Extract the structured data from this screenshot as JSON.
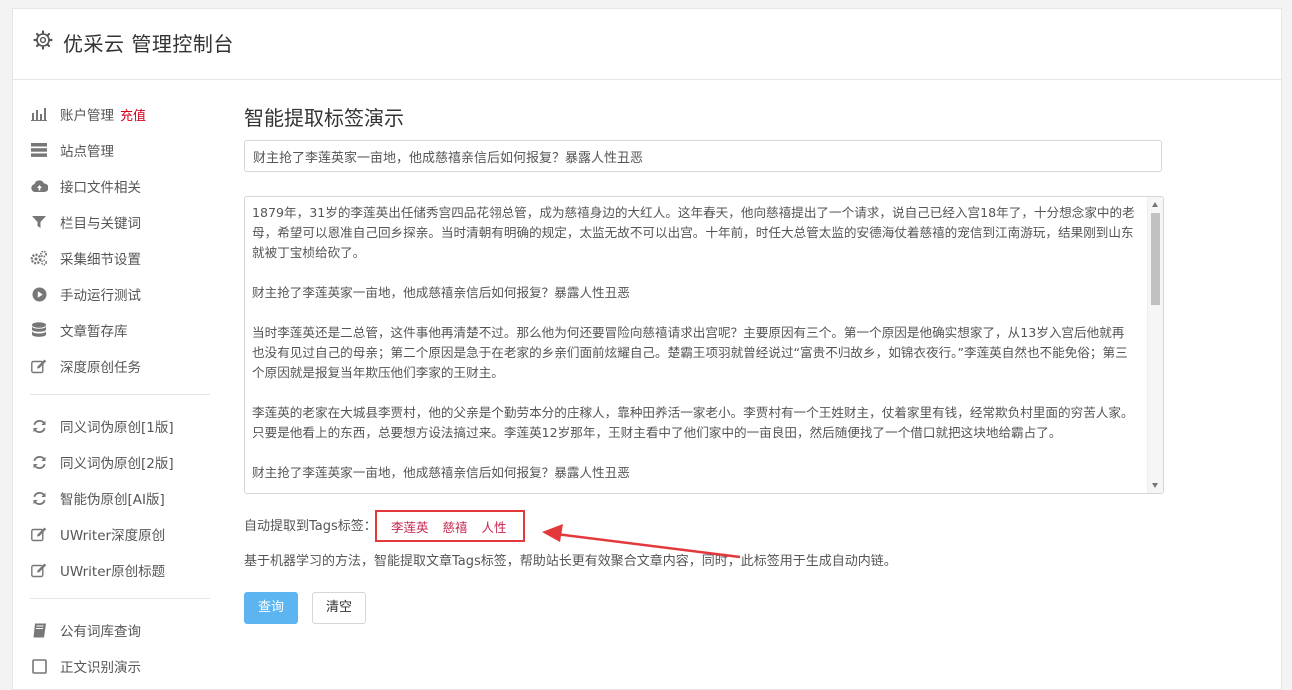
{
  "app": {
    "title": "优采云 管理控制台"
  },
  "sidebar": {
    "groups": [
      [
        {
          "icon": "bar-chart-icon",
          "label": "账户管理",
          "badge": "充值"
        },
        {
          "icon": "server-icon",
          "label": "站点管理"
        },
        {
          "icon": "cloud-upload-icon",
          "label": "接口文件相关"
        },
        {
          "icon": "filter-icon",
          "label": "栏目与关键词"
        },
        {
          "icon": "gears-icon",
          "label": "采集细节设置"
        },
        {
          "icon": "play-circle-icon",
          "label": "手动运行测试"
        },
        {
          "icon": "database-icon",
          "label": "文章暂存库"
        },
        {
          "icon": "edit-icon",
          "label": "深度原创任务"
        }
      ],
      [
        {
          "icon": "refresh-icon",
          "label": "同义词伪原创[1版]"
        },
        {
          "icon": "refresh-icon",
          "label": "同义词伪原创[2版]"
        },
        {
          "icon": "refresh-icon",
          "label": "智能伪原创[AI版]"
        },
        {
          "icon": "edit-icon",
          "label": "UWriter深度原创"
        },
        {
          "icon": "edit-icon",
          "label": "UWriter原创标题"
        }
      ],
      [
        {
          "icon": "book-icon",
          "label": "公有词库查询"
        },
        {
          "icon": "square-icon",
          "label": "正文识别演示"
        }
      ]
    ]
  },
  "main": {
    "heading": "智能提取标签演示",
    "title_value": "财主抢了李莲英家一亩地，他成慈禧亲信后如何报复？暴露人性丑恶",
    "content_paragraphs": [
      "1879年，31岁的李莲英出任储秀宫四品花翎总管，成为慈禧身边的大红人。这年春天，他向慈禧提出了一个请求，说自己已经入宫18年了，十分想念家中的老母，希望可以恩准自己回乡探亲。当时清朝有明确的规定，太监无故不可以出宫。十年前，时任大总管太监的安德海仗着慈禧的宠信到江南游玩，结果刚到山东就被丁宝桢给砍了。",
      "财主抢了李莲英家一亩地，他成慈禧亲信后如何报复？暴露人性丑恶",
      "当时李莲英还是二总管，这件事他再清楚不过。那么他为何还要冒险向慈禧请求出宫呢？主要原因有三个。第一个原因是他确实想家了，从13岁入宫后他就再也没有见过自己的母亲；第二个原因是急于在老家的乡亲们面前炫耀自己。楚霸王项羽就曾经说过“富贵不归故乡，如锦衣夜行。”李莲英自然也不能免俗；第三个原因就是报复当年欺压他们李家的王财主。",
      "李莲英的老家在大城县李贾村，他的父亲是个勤劳本分的庄稼人，靠种田养活一家老小。李贾村有一个王姓财主，仗着家里有钱，经常欺负村里面的穷苦人家。只要是他看上的东西，总要想方设法搞过来。李莲英12岁那年，王财主看中了他们家中的一亩良田，然后随便找了一个借口就把这块地给霸占了。",
      "财主抢了李莲英家一亩地，他成慈禧亲信后如何报复？暴露人性丑恶"
    ],
    "tags_label": "自动提取到Tags标签：",
    "tags": [
      "李莲英",
      "慈禧",
      "人性"
    ],
    "description": "基于机器学习的方法，智能提取文章Tags标签，帮助站长更有效聚合文章内容，同时，此标签用于生成自动内链。",
    "query_button": "查询",
    "clear_button": "清空"
  },
  "colors": {
    "accent_button": "#5cb5f0",
    "highlight_border": "#e4393c",
    "tag_text": "#c7254e",
    "badge_text": "#d9001b"
  }
}
